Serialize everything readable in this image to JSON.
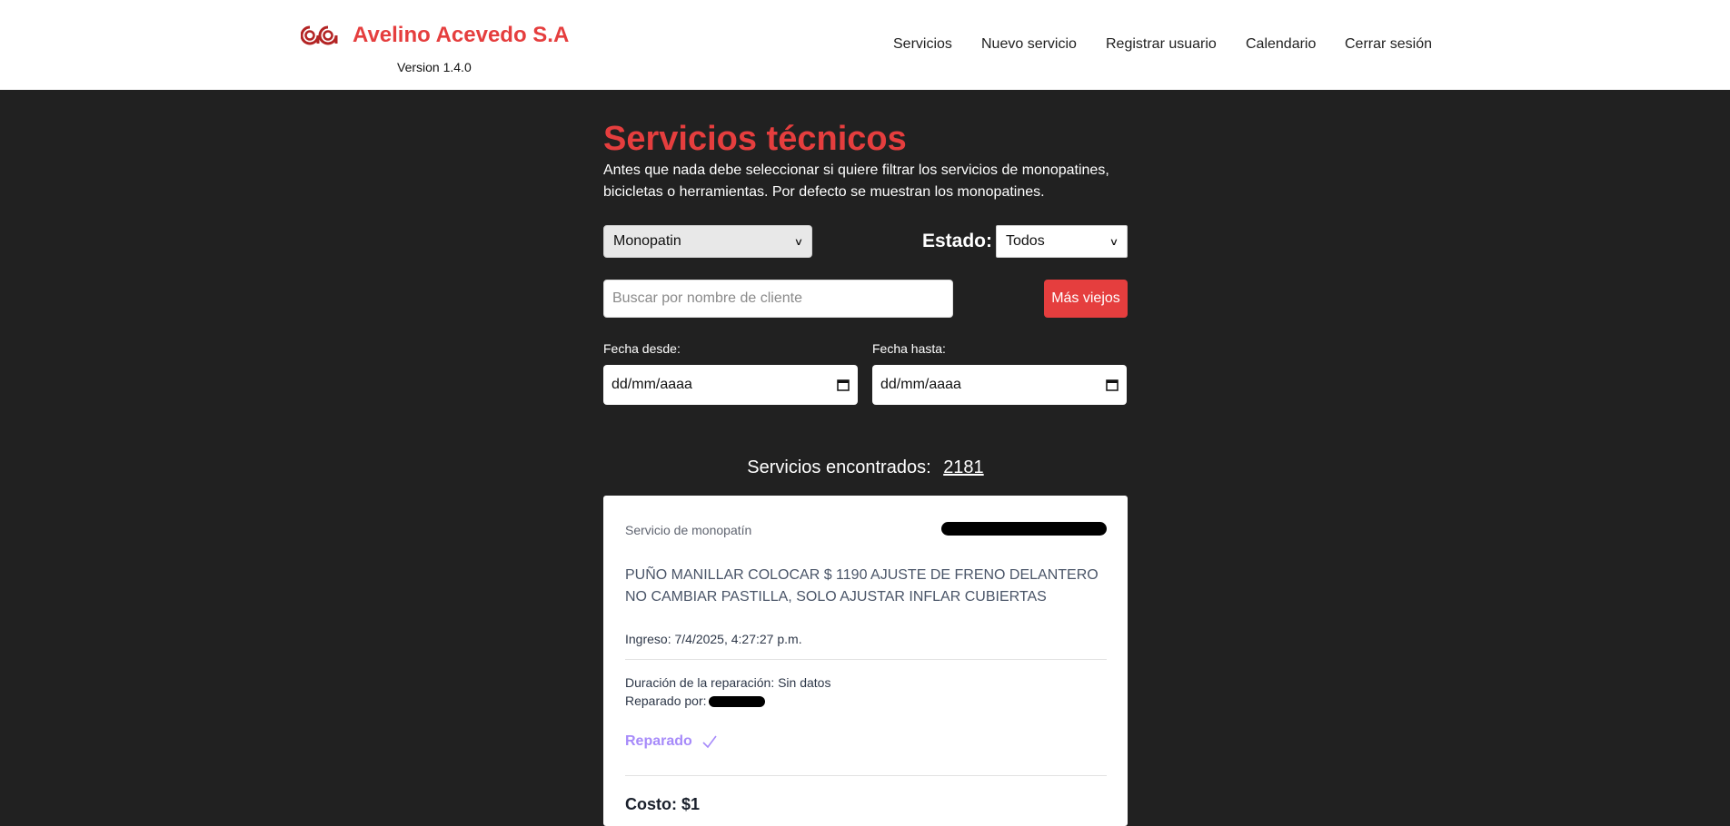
{
  "header": {
    "brand": "Avelino Acevedo S.A",
    "version": "Version 1.4.0",
    "nav": [
      "Servicios",
      "Nuevo servicio",
      "Registrar usuario",
      "Calendario",
      "Cerrar sesión"
    ]
  },
  "main": {
    "title": "Servicios técnicos",
    "intro": "Antes que nada debe seleccionar si quiere filtrar los servicios de monopatines, bicicletas o herramientas. Por defecto se muestran los monopatines.",
    "type_select": "Monopatin",
    "estado_label": "Estado:",
    "estado_select": "Todos",
    "search_placeholder": "Buscar por nombre de cliente",
    "sort_button": "Más viejos",
    "date_from_label": "Fecha desde:",
    "date_to_label": "Fecha hasta:",
    "date_from_value": "dd/mm/aaaa",
    "date_to_value": "dd/mm/aaaa",
    "count_label": "Servicios encontrados:",
    "count_value": "2181"
  },
  "card": {
    "type": "Servicio de monopatín",
    "description": "PUÑO MANILLAR COLOCAR $ 1190 AJUSTE DE FRENO DELANTERO NO CAMBIAR PASTILLA, SOLO AJUSTAR INFLAR CUBIERTAS",
    "ingreso": "Ingreso: 7/4/2025, 4:27:27 p.m.",
    "duracion": "Duración de la reparación: Sin datos",
    "reparado_por": "Reparado por:",
    "status": "Reparado",
    "costo": "Costo: $1"
  },
  "colors": {
    "accent": "#e53e3e",
    "background": "#212121",
    "status": "#a78bfa"
  },
  "icons": [
    "logo-icon",
    "chevron-down-icon",
    "calendar-icon",
    "check-icon"
  ]
}
